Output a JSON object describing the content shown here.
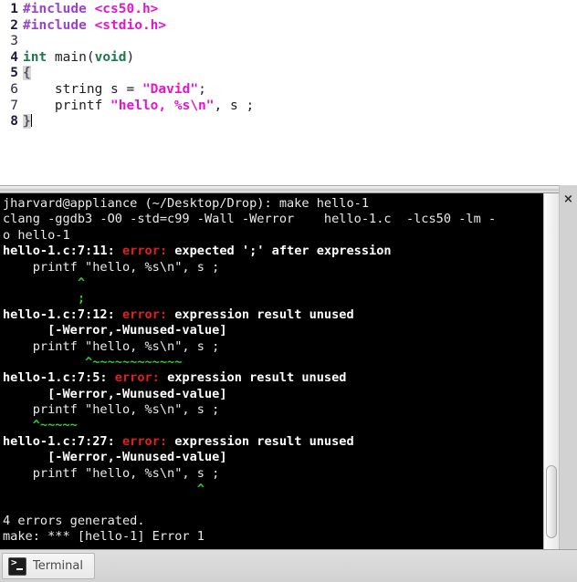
{
  "editor": {
    "lines": [
      {
        "num": "1",
        "bold": true,
        "tokens": [
          {
            "t": "#include ",
            "c": "tok-pre"
          },
          {
            "t": "<cs50.h>",
            "c": "tok-header"
          }
        ]
      },
      {
        "num": "2",
        "bold": true,
        "tokens": [
          {
            "t": "#include ",
            "c": "tok-pre"
          },
          {
            "t": "<stdio.h>",
            "c": "tok-header"
          }
        ]
      },
      {
        "num": "3",
        "bold": false,
        "tokens": []
      },
      {
        "num": "4",
        "bold": true,
        "tokens": [
          {
            "t": "int",
            "c": "tok-type"
          },
          {
            "t": " main(",
            "c": "tok-id"
          },
          {
            "t": "void",
            "c": "tok-type"
          },
          {
            "t": ")",
            "c": "tok-id"
          }
        ]
      },
      {
        "num": "5",
        "bold": true,
        "tokens": [
          {
            "t": "{",
            "c": "tok-brace"
          }
        ]
      },
      {
        "num": "6",
        "bold": false,
        "tokens": [
          {
            "t": "    string s = ",
            "c": "tok-id"
          },
          {
            "t": "\"David\"",
            "c": "tok-str"
          },
          {
            "t": ";",
            "c": "tok-punct"
          }
        ]
      },
      {
        "num": "7",
        "bold": false,
        "tokens": [
          {
            "t": "    printf ",
            "c": "tok-id"
          },
          {
            "t": "\"hello, %s\\n\"",
            "c": "tok-str"
          },
          {
            "t": ", s ;",
            "c": "tok-punct"
          }
        ]
      },
      {
        "num": "8",
        "bold": true,
        "tokens": [
          {
            "t": "}",
            "c": "tok-brace"
          }
        ],
        "cursor": true
      }
    ]
  },
  "terminal": {
    "lines": [
      [
        {
          "t": "jharvard@appliance (~/Desktop/Drop): make hello-1",
          "c": "t-w"
        }
      ],
      [
        {
          "t": "clang -ggdb3 -O0 -std=c99 -Wall -Werror    hello-1.c  -lcs50 -lm -",
          "c": "t-w"
        }
      ],
      [
        {
          "t": "o hello-1",
          "c": "t-w"
        }
      ],
      [
        {
          "t": "hello-1.c:7:11: ",
          "c": "t-b"
        },
        {
          "t": "error: ",
          "c": "t-red"
        },
        {
          "t": "expected ';' after expression",
          "c": "t-b"
        }
      ],
      [
        {
          "t": "    printf \"hello, %s\\n\", s ;",
          "c": "t-w"
        }
      ],
      [
        {
          "t": "          ^",
          "c": "t-grn"
        }
      ],
      [
        {
          "t": "          ;",
          "c": "t-grn"
        }
      ],
      [
        {
          "t": "hello-1.c:7:12: ",
          "c": "t-b"
        },
        {
          "t": "error: ",
          "c": "t-red"
        },
        {
          "t": "expression result unused",
          "c": "t-b"
        }
      ],
      [
        {
          "t": "      [-Werror,-Wunused-value]",
          "c": "t-b"
        }
      ],
      [
        {
          "t": "    printf \"hello, %s\\n\", s ;",
          "c": "t-w"
        }
      ],
      [
        {
          "t": "           ^~~~~~~~~~~~~",
          "c": "t-grn"
        }
      ],
      [
        {
          "t": "hello-1.c:7:5: ",
          "c": "t-b"
        },
        {
          "t": "error: ",
          "c": "t-red"
        },
        {
          "t": "expression result unused",
          "c": "t-b"
        }
      ],
      [
        {
          "t": "      [-Werror,-Wunused-value]",
          "c": "t-b"
        }
      ],
      [
        {
          "t": "    printf \"hello, %s\\n\", s ;",
          "c": "t-w"
        }
      ],
      [
        {
          "t": "    ^~~~~~",
          "c": "t-grn"
        }
      ],
      [
        {
          "t": "hello-1.c:7:27: ",
          "c": "t-b"
        },
        {
          "t": "error: ",
          "c": "t-red"
        },
        {
          "t": "expression result unused",
          "c": "t-b"
        }
      ],
      [
        {
          "t": "      [-Werror,-Wunused-value]",
          "c": "t-b"
        }
      ],
      [
        {
          "t": "    printf \"hello, %s\\n\", s ;",
          "c": "t-w"
        }
      ],
      [
        {
          "t": "                          ^",
          "c": "t-grn"
        }
      ],
      [],
      [
        {
          "t": "4 errors generated.",
          "c": "t-w"
        }
      ],
      [
        {
          "t": "make: *** [hello-1] Error 1",
          "c": "t-w"
        }
      ]
    ]
  },
  "window_controls": {
    "close_label": "×"
  },
  "taskbar": {
    "terminal_label": "Terminal"
  },
  "colors": {
    "terminal_bg": "#000000",
    "error_red": "#e02020",
    "caret_green": "#2ecc2e",
    "string_magenta": "#e315d0",
    "keyword_green": "#1a7a4a",
    "preproc_purple": "#9a44c9"
  }
}
